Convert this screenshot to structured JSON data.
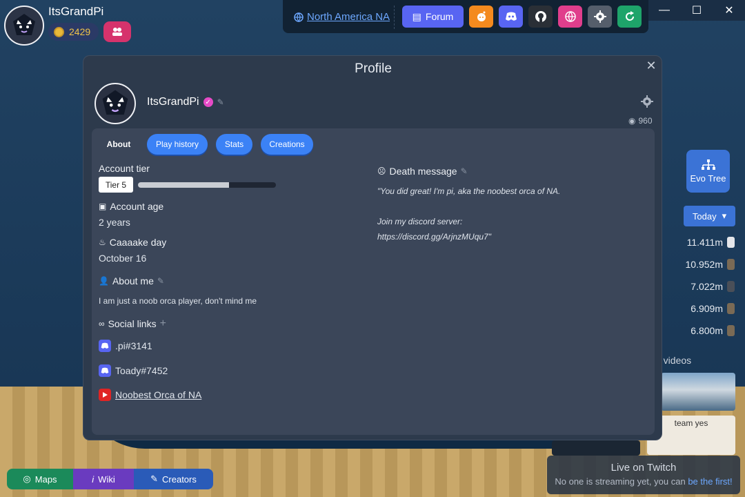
{
  "player": {
    "name": "ItsGrandPi",
    "coins": "2429"
  },
  "topbar": {
    "region": "North America NA",
    "forum_label": "Forum"
  },
  "right_panel": {
    "evo_tree_label": "Evo Tree",
    "range_label": "Today",
    "leaderboard": [
      {
        "value": "11.411m",
        "icon": "white"
      },
      {
        "value": "10.952m",
        "icon": "brown"
      },
      {
        "value": "7.022m",
        "icon": "dark"
      },
      {
        "value": "6.909m",
        "icon": "brown"
      },
      {
        "value": "6.800m",
        "icon": "brown"
      }
    ],
    "videos_label": "e videos",
    "video_caption": "team yes",
    "twitch_title": "Live on Twitch",
    "twitch_text": "No one is streaming yet, you can",
    "twitch_link": "be the first!"
  },
  "bottom_bar": {
    "maps": "Maps",
    "wiki": "Wiki",
    "creators": "Creators"
  },
  "modal": {
    "title": "Profile",
    "name": "ItsGrandPi",
    "views": "960",
    "tabs": {
      "about": "About",
      "play_history": "Play history",
      "stats": "Stats",
      "creations": "Creations"
    },
    "account_tier_label": "Account tier",
    "tier": "Tier 5",
    "tier_progress": 0.66,
    "account_age_label": "Account age",
    "account_age": "2 years",
    "cake_day_label": "Caaaake day",
    "cake_day": "October 16",
    "about_me_label": "About me",
    "about_me": "I am just a noob orca player, don't mind me",
    "social_label": "Social links",
    "socials": [
      {
        "type": "discord",
        "text": ".pi#3141"
      },
      {
        "type": "discord",
        "text": "Toady#7452"
      },
      {
        "type": "youtube",
        "text": "Noobest Orca of NA"
      }
    ],
    "death_label": "Death message",
    "death_line1": "\"You did great! I'm pi, aka the noobest orca of NA.",
    "death_line2": "Join my discord server:",
    "death_line3": "https://discord.gg/ArjnzMUqu7\""
  }
}
